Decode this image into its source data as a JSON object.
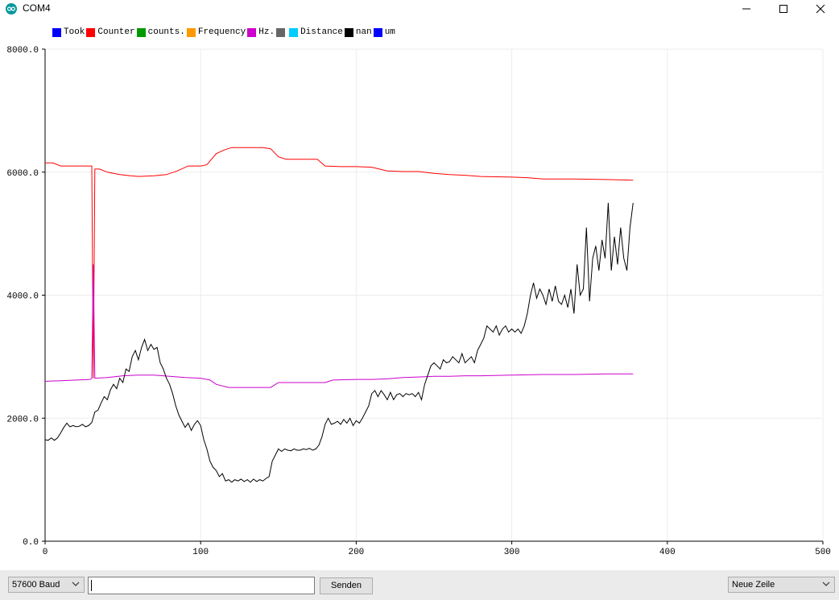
{
  "window": {
    "title": "COM4",
    "minimize_icon": "minimize-icon",
    "maximize_icon": "maximize-icon",
    "close_icon": "close-icon"
  },
  "legend": [
    {
      "label": "Took",
      "color": "#0000ff"
    },
    {
      "label": "Counter",
      "color": "#ff0000"
    },
    {
      "label": "counts.",
      "color": "#009900"
    },
    {
      "label": "Frequency",
      "color": "#ff9900"
    },
    {
      "label": "Hz.",
      "color": "#cc00cc"
    },
    {
      "label": "",
      "color": "#666666"
    },
    {
      "label": "Distance",
      "color": "#00ccff"
    },
    {
      "label": "nan",
      "color": "#000000"
    },
    {
      "label": "um",
      "color": "#0000ff"
    }
  ],
  "chart_data": {
    "type": "line",
    "xlim": [
      0,
      500
    ],
    "ylim": [
      0,
      8000
    ],
    "x_ticks": [
      "0",
      "100",
      "200",
      "300",
      "400",
      "500"
    ],
    "y_ticks": [
      "0.0",
      "2000.0",
      "4000.0",
      "6000.0",
      "8000.0"
    ],
    "grid": true,
    "legend_position": "top-left",
    "series": [
      {
        "name": "Counter",
        "color": "#ff0000",
        "points": [
          [
            0,
            6150
          ],
          [
            5,
            6150
          ],
          [
            10,
            6100
          ],
          [
            20,
            6100
          ],
          [
            29,
            6100
          ],
          [
            30,
            6100
          ],
          [
            31,
            2650
          ],
          [
            32,
            6050
          ],
          [
            35,
            6050
          ],
          [
            40,
            6000
          ],
          [
            48,
            5960
          ],
          [
            55,
            5940
          ],
          [
            60,
            5930
          ],
          [
            70,
            5940
          ],
          [
            78,
            5960
          ],
          [
            85,
            6020
          ],
          [
            92,
            6100
          ],
          [
            100,
            6100
          ],
          [
            104,
            6120
          ],
          [
            110,
            6300
          ],
          [
            115,
            6360
          ],
          [
            120,
            6400
          ],
          [
            130,
            6400
          ],
          [
            140,
            6400
          ],
          [
            145,
            6380
          ],
          [
            150,
            6250
          ],
          [
            155,
            6210
          ],
          [
            170,
            6210
          ],
          [
            175,
            6210
          ],
          [
            180,
            6100
          ],
          [
            190,
            6090
          ],
          [
            200,
            6090
          ],
          [
            210,
            6080
          ],
          [
            220,
            6020
          ],
          [
            230,
            6010
          ],
          [
            240,
            6010
          ],
          [
            250,
            5980
          ],
          [
            260,
            5960
          ],
          [
            270,
            5950
          ],
          [
            280,
            5930
          ],
          [
            300,
            5920
          ],
          [
            310,
            5910
          ],
          [
            320,
            5890
          ],
          [
            340,
            5890
          ],
          [
            360,
            5880
          ],
          [
            378,
            5870
          ]
        ]
      },
      {
        "name": "Hz.",
        "color": "#cc00cc",
        "points": [
          [
            0,
            2600
          ],
          [
            10,
            2610
          ],
          [
            20,
            2620
          ],
          [
            29,
            2630
          ],
          [
            30,
            2650
          ],
          [
            31,
            4500
          ],
          [
            32,
            2650
          ],
          [
            40,
            2660
          ],
          [
            50,
            2690
          ],
          [
            60,
            2700
          ],
          [
            70,
            2700
          ],
          [
            80,
            2680
          ],
          [
            90,
            2660
          ],
          [
            100,
            2650
          ],
          [
            106,
            2620
          ],
          [
            110,
            2550
          ],
          [
            118,
            2500
          ],
          [
            130,
            2500
          ],
          [
            140,
            2500
          ],
          [
            145,
            2500
          ],
          [
            150,
            2580
          ],
          [
            160,
            2580
          ],
          [
            170,
            2580
          ],
          [
            180,
            2580
          ],
          [
            185,
            2620
          ],
          [
            200,
            2630
          ],
          [
            210,
            2630
          ],
          [
            220,
            2640
          ],
          [
            230,
            2660
          ],
          [
            240,
            2670
          ],
          [
            250,
            2680
          ],
          [
            260,
            2680
          ],
          [
            270,
            2690
          ],
          [
            280,
            2690
          ],
          [
            300,
            2700
          ],
          [
            320,
            2710
          ],
          [
            340,
            2710
          ],
          [
            360,
            2720
          ],
          [
            378,
            2720
          ]
        ]
      },
      {
        "name": "nan",
        "color": "#000000",
        "points": [
          [
            0,
            1650
          ],
          [
            2,
            1640
          ],
          [
            4,
            1680
          ],
          [
            6,
            1640
          ],
          [
            8,
            1680
          ],
          [
            10,
            1760
          ],
          [
            12,
            1850
          ],
          [
            14,
            1920
          ],
          [
            16,
            1860
          ],
          [
            18,
            1880
          ],
          [
            20,
            1860
          ],
          [
            22,
            1870
          ],
          [
            24,
            1900
          ],
          [
            26,
            1860
          ],
          [
            28,
            1880
          ],
          [
            30,
            1930
          ],
          [
            32,
            2100
          ],
          [
            34,
            2130
          ],
          [
            36,
            2250
          ],
          [
            38,
            2350
          ],
          [
            40,
            2300
          ],
          [
            42,
            2460
          ],
          [
            44,
            2550
          ],
          [
            46,
            2480
          ],
          [
            48,
            2650
          ],
          [
            50,
            2580
          ],
          [
            52,
            2800
          ],
          [
            54,
            2760
          ],
          [
            56,
            3000
          ],
          [
            58,
            3100
          ],
          [
            60,
            2950
          ],
          [
            62,
            3150
          ],
          [
            64,
            3280
          ],
          [
            66,
            3100
          ],
          [
            68,
            3200
          ],
          [
            70,
            3120
          ],
          [
            72,
            3150
          ],
          [
            74,
            2900
          ],
          [
            76,
            2800
          ],
          [
            78,
            2650
          ],
          [
            80,
            2550
          ],
          [
            82,
            2400
          ],
          [
            84,
            2200
          ],
          [
            86,
            2050
          ],
          [
            88,
            1950
          ],
          [
            90,
            1850
          ],
          [
            92,
            1920
          ],
          [
            94,
            1800
          ],
          [
            96,
            1900
          ],
          [
            98,
            1960
          ],
          [
            100,
            1880
          ],
          [
            102,
            1650
          ],
          [
            104,
            1500
          ],
          [
            106,
            1300
          ],
          [
            108,
            1200
          ],
          [
            110,
            1150
          ],
          [
            112,
            1050
          ],
          [
            114,
            1100
          ],
          [
            116,
            980
          ],
          [
            118,
            1000
          ],
          [
            120,
            960
          ],
          [
            122,
            1000
          ],
          [
            124,
            980
          ],
          [
            126,
            1010
          ],
          [
            128,
            970
          ],
          [
            130,
            1000
          ],
          [
            132,
            960
          ],
          [
            134,
            1010
          ],
          [
            136,
            970
          ],
          [
            138,
            1000
          ],
          [
            140,
            980
          ],
          [
            142,
            1020
          ],
          [
            144,
            1050
          ],
          [
            146,
            1300
          ],
          [
            148,
            1400
          ],
          [
            150,
            1500
          ],
          [
            152,
            1460
          ],
          [
            154,
            1500
          ],
          [
            156,
            1480
          ],
          [
            158,
            1470
          ],
          [
            160,
            1500
          ],
          [
            162,
            1480
          ],
          [
            164,
            1480
          ],
          [
            166,
            1500
          ],
          [
            168,
            1490
          ],
          [
            170,
            1510
          ],
          [
            172,
            1480
          ],
          [
            174,
            1500
          ],
          [
            176,
            1560
          ],
          [
            178,
            1700
          ],
          [
            180,
            1900
          ],
          [
            182,
            2000
          ],
          [
            184,
            1900
          ],
          [
            186,
            1920
          ],
          [
            188,
            1950
          ],
          [
            190,
            1900
          ],
          [
            192,
            1980
          ],
          [
            194,
            1920
          ],
          [
            196,
            2000
          ],
          [
            198,
            1880
          ],
          [
            200,
            1960
          ],
          [
            202,
            1920
          ],
          [
            204,
            2000
          ],
          [
            206,
            2100
          ],
          [
            208,
            2200
          ],
          [
            210,
            2400
          ],
          [
            212,
            2450
          ],
          [
            214,
            2350
          ],
          [
            216,
            2450
          ],
          [
            218,
            2380
          ],
          [
            220,
            2300
          ],
          [
            222,
            2420
          ],
          [
            224,
            2300
          ],
          [
            226,
            2380
          ],
          [
            228,
            2400
          ],
          [
            230,
            2350
          ],
          [
            232,
            2400
          ],
          [
            234,
            2380
          ],
          [
            236,
            2400
          ],
          [
            238,
            2350
          ],
          [
            240,
            2420
          ],
          [
            242,
            2300
          ],
          [
            244,
            2550
          ],
          [
            246,
            2700
          ],
          [
            248,
            2850
          ],
          [
            250,
            2900
          ],
          [
            252,
            2850
          ],
          [
            254,
            2800
          ],
          [
            256,
            2950
          ],
          [
            258,
            2900
          ],
          [
            260,
            2920
          ],
          [
            262,
            3000
          ],
          [
            264,
            2950
          ],
          [
            266,
            2900
          ],
          [
            268,
            3050
          ],
          [
            270,
            2900
          ],
          [
            272,
            2950
          ],
          [
            274,
            3000
          ],
          [
            276,
            2900
          ],
          [
            278,
            3100
          ],
          [
            280,
            3200
          ],
          [
            282,
            3300
          ],
          [
            284,
            3500
          ],
          [
            286,
            3450
          ],
          [
            288,
            3400
          ],
          [
            290,
            3500
          ],
          [
            292,
            3350
          ],
          [
            294,
            3450
          ],
          [
            296,
            3500
          ],
          [
            298,
            3400
          ],
          [
            300,
            3450
          ],
          [
            302,
            3400
          ],
          [
            304,
            3450
          ],
          [
            306,
            3380
          ],
          [
            308,
            3500
          ],
          [
            310,
            3700
          ],
          [
            312,
            4000
          ],
          [
            314,
            4200
          ],
          [
            316,
            3950
          ],
          [
            318,
            4100
          ],
          [
            320,
            4000
          ],
          [
            322,
            3850
          ],
          [
            324,
            4100
          ],
          [
            326,
            3900
          ],
          [
            328,
            4150
          ],
          [
            330,
            3900
          ],
          [
            332,
            3850
          ],
          [
            334,
            4000
          ],
          [
            336,
            3800
          ],
          [
            338,
            4100
          ],
          [
            340,
            3700
          ],
          [
            342,
            4500
          ],
          [
            344,
            4000
          ],
          [
            346,
            4100
          ],
          [
            348,
            5100
          ],
          [
            350,
            3900
          ],
          [
            352,
            4600
          ],
          [
            354,
            4800
          ],
          [
            356,
            4400
          ],
          [
            358,
            4900
          ],
          [
            360,
            4600
          ],
          [
            362,
            5500
          ],
          [
            364,
            4400
          ],
          [
            366,
            4950
          ],
          [
            368,
            4500
          ],
          [
            370,
            5100
          ],
          [
            372,
            4600
          ],
          [
            374,
            4400
          ],
          [
            376,
            5100
          ],
          [
            378,
            5500
          ]
        ]
      }
    ]
  },
  "bottom": {
    "baud": "57600 Baud",
    "input_value": "",
    "send_label": "Senden",
    "line_ending": "Neue Zeile"
  }
}
